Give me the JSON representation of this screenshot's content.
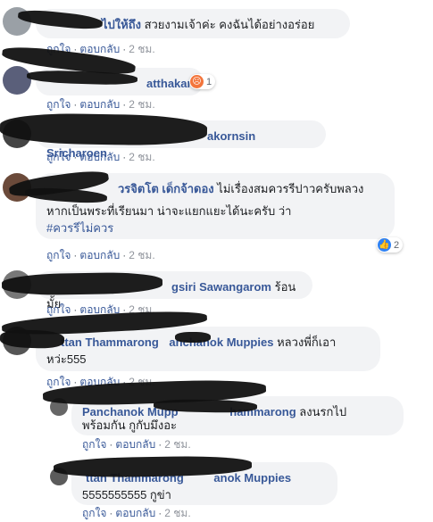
{
  "comments": [
    {
      "name": "ไปให้ถึง",
      "text": "สวยงามเจ้าค่ะ คงฉันได้อย่างอร่อย",
      "like": "ถูกใจ",
      "reply": "ตอบกลับ",
      "time": "2 ชม."
    },
    {
      "name": "Wissa Watthakarn",
      "name_visible": "atthakarn",
      "reaction_count": "1",
      "reaction_icon": "angry-emoji",
      "like": "ถูกใจ",
      "reply": "ตอบกลับ",
      "time": "2 ชม."
    },
    {
      "name_visible": "akornsin Sricharoen",
      "like": "ถูกใจ",
      "reply": "ตอบกลับ",
      "time": "2 ชม."
    },
    {
      "name": "วรจิตโต เด็กจ้าดอง",
      "text": "ไม่เรื่องสมควรรีปาวครับพลวง",
      "text2": "หากเป็นพระที่เรียนมา น่าจะแยกแยะได้นะครับ ว่า",
      "hashtag": "#ควรรีไม่ควร",
      "reaction_count": "2",
      "reaction_icon": "like-emoji",
      "like": "ถูกใจ",
      "reply": "ตอบกลับ",
      "time": "2 ชม."
    },
    {
      "name_visible": "gsiri Sawangarom",
      "text": "ร้อนมั้ย",
      "like": "ถูกใจ",
      "reply": "ตอบกลับ",
      "time": "2 ชม."
    },
    {
      "name": "ttan Thammarong",
      "mention": "anchanok Muppies",
      "text": "หลวงพี่ก็เอา",
      "text2": "หว่ะ555",
      "like": "ถูกใจ",
      "reply": "ตอบกลับ",
      "time": "2 ชม."
    }
  ],
  "replies": [
    {
      "name": "Panchanok Mupp",
      "mention": "hammarong",
      "text": "ลงนรกไป",
      "text2": "พร้อมกัน กูกับมึงอะ",
      "like": "ถูกใจ",
      "reply": "ตอบกลับ",
      "time": "2 ชม."
    },
    {
      "name": "ttan Thammarong",
      "mention": "anok Muppies",
      "text": "5555555555 กูข่า",
      "like": "ถูกใจ",
      "reply": "ตอบกลับ",
      "time": "2 ชม."
    }
  ]
}
